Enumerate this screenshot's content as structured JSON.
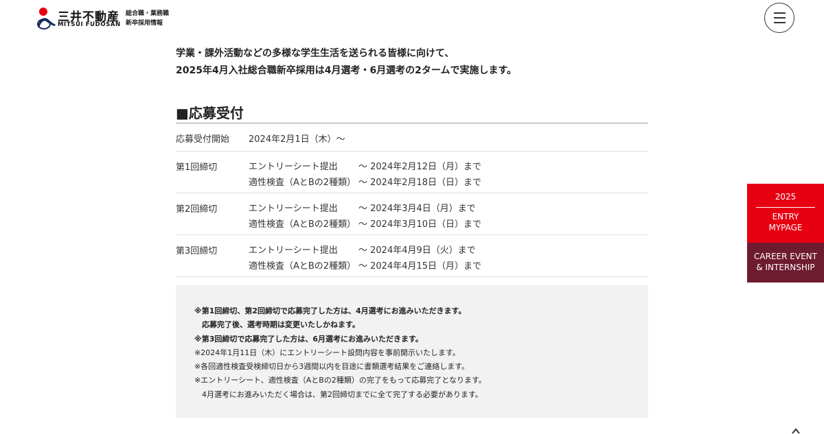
{
  "header": {
    "logo_jp": "三井不動産",
    "logo_en": "MITSUI FUDOSAN",
    "sub_line1": "総合職・業務職",
    "sub_line2": "新卒採用情報",
    "menu_icon": "hamburger-icon"
  },
  "intro": {
    "line1": "学業・課外活動などの多様な学生生活を送られる皆様に向けて、",
    "line2": "2025年4月入社総合職新卒採用は4月選考・6月選考の2タームで実施します。"
  },
  "section": {
    "title": "■応募受付",
    "start": {
      "label": "応募受付開始",
      "value": "2024年2月1日（木）〜"
    },
    "deadlines": [
      {
        "label": "第1回締切",
        "items": [
          {
            "name": "エントリーシート提出",
            "date": "〜 2024年2月12日（月）まで"
          },
          {
            "name": "適性検査（AとBの2種類）",
            "date": "〜 2024年2月18日（日）まで"
          }
        ]
      },
      {
        "label": "第2回締切",
        "items": [
          {
            "name": "エントリーシート提出",
            "date": "〜 2024年3月4日（月）まで"
          },
          {
            "name": "適性検査（AとBの2種類）",
            "date": "〜 2024年3月10日（日）まで"
          }
        ]
      },
      {
        "label": "第3回締切",
        "items": [
          {
            "name": "エントリーシート提出",
            "date": "〜 2024年4月9日（火）まで"
          },
          {
            "name": "適性検査（AとBの2種類）",
            "date": "〜 2024年4月15日（月）まで"
          }
        ]
      }
    ]
  },
  "notes": {
    "n1": "※第1回締切、第2回締切で応募完了した方は、4月選考にお進みいただきます。",
    "n1b": "応募完了後、選考時期は変更いたしかねます。",
    "n2": "※第3回締切で応募完了した方は、6月選考にお進みいただきます。",
    "n3": "※2024年1月11日（木）にエントリーシート設問内容を事前開示いたします。",
    "n4": "※各回適性検査受検締切日から3週間以内を目途に書類選考結果をご連絡します。",
    "n5": "※エントリーシート、適性検査（AとBの2種類）の完了をもって応募完了となります。",
    "n5b": "4月選考にお進みいただく場合は、第2回締切までに全て完了する必要があります。"
  },
  "side": {
    "year": "2025",
    "entry": "ENTRY",
    "mypage": "MYPAGE",
    "career1": "CAREER EVENT",
    "career2": "& INTERNSHIP"
  },
  "colors": {
    "brand_red": "#e60012",
    "career_bg": "#6e1a2f",
    "notes_bg": "#f2f2f2"
  }
}
